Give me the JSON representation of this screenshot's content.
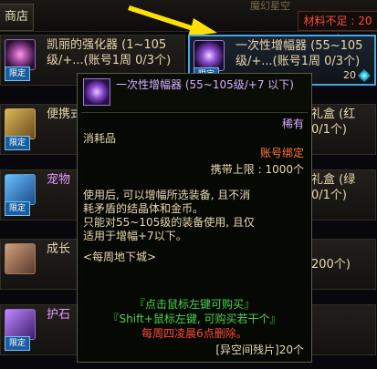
{
  "header": {
    "shop_tab": "商店",
    "title": "魔幻星空",
    "status": "材料不足 : 20个"
  },
  "rows": [
    {
      "name": "凯丽的强化器 (1~105",
      "sub": "级/+...(账号1周 0/3个)",
      "limit": "限定"
    },
    {
      "name": "一次性增幅器 (55~105",
      "sub": "级/+...(账号1周 0/3个)",
      "limit": "限定",
      "price": "20"
    },
    {
      "name": "便携式",
      "limit": "限定"
    },
    {
      "name": "礼盒 (红",
      "sub": "0/1个)"
    },
    {
      "name": "宠物",
      "limit": "限定"
    },
    {
      "name": "礼盒 (绿",
      "sub": "0/1个)"
    },
    {
      "name": "成长",
      "sub": "200个)"
    },
    {
      "name": "护石",
      "limit": "限定"
    }
  ],
  "tooltip": {
    "title": "一次性增幅器 (55~105级/+7 以下)",
    "rarity": "稀有",
    "category": "消耗品",
    "bind": "账号绑定",
    "carry_limit": "携带上限 : 1000个",
    "desc1": "使用后, 可以增幅所选装备, 且不消",
    "desc2": "耗矛盾的结晶体和金币。",
    "desc3": "只能对55~105级的装备使用, 且仅",
    "desc4": "适用于增幅+7以下。",
    "weekly": "<每周地下城>",
    "hint1": "『点击鼠标左键可购买』",
    "hint2": "『Shift+鼠标左键, 可购买若干个』",
    "reset": "每周四凌晨6点删除。",
    "cost": "[异空间残片]20个"
  },
  "colors": {
    "accent": "#3fa8e8",
    "rare": "#d8b0ff",
    "bind": "#ff7a3a",
    "hint": "#50d050",
    "reset": "#ff4a3a"
  }
}
